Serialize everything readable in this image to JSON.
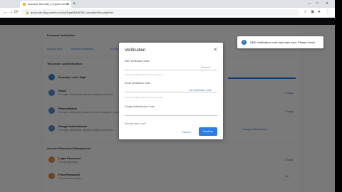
{
  "browser": {
    "tab_title": "Account Security | Crypto Curren",
    "new_tab_symbol": "+",
    "url": "accounts.bitg.com/en-us/dol/DpaEBHAT8lU-security/SecurityPwd",
    "window": {
      "minimize": "—",
      "maximize": "□",
      "close": "✕"
    }
  },
  "page": {
    "personal_verification": {
      "title": "Personal Verification",
      "links": [
        "Account Verif.",
        "Personal Verification",
        "Personal Info"
      ]
    },
    "two_factor": {
      "title": "Two-factor Authentication",
      "rows": [
        {
          "title": "Security Level: High",
          "desc": ""
        },
        {
          "title": "Email",
          "desc": "For login, withdrawal, security settings and others",
          "action": "Change"
        },
        {
          "title": "Phone/Mobile",
          "desc": "For login, withdrawal, password reset, changes to security settings",
          "action": "Change"
        },
        {
          "title": "Google Authenticator",
          "desc": "For login, withdrawal, security settings and others",
          "action": "Change Authenticator"
        }
      ]
    },
    "password_mgmt": {
      "title": "Account Password Management",
      "rows": [
        {
          "title": "Login Password",
          "desc": "For account login",
          "action": "Change"
        },
        {
          "title": "Fund Password",
          "desc": "For account security",
          "action": "Set"
        }
      ]
    }
  },
  "dialog": {
    "title": "Verification",
    "close_symbol": "✕",
    "sms_label": "SMS Verification Code",
    "sms_resend": "Resend",
    "sms_hint": "Enter the 6-digit code sent to your phone",
    "email_label": "Email Verification Code",
    "email_link": "Get verification code",
    "email_hint": "Enter the 6-digit code sent to your email",
    "google_label": "Google Authenticator Code",
    "security_label": "Security Item Lost?",
    "cancel_label": "Cancel",
    "confirm_label": "Confirm"
  },
  "toast": {
    "icon": "✓",
    "message": "SMS verification code has been sent. Please check."
  },
  "colors": {
    "accent": "#2b7de9",
    "header": "#14151a",
    "toast_icon": "#2f6fb3"
  }
}
